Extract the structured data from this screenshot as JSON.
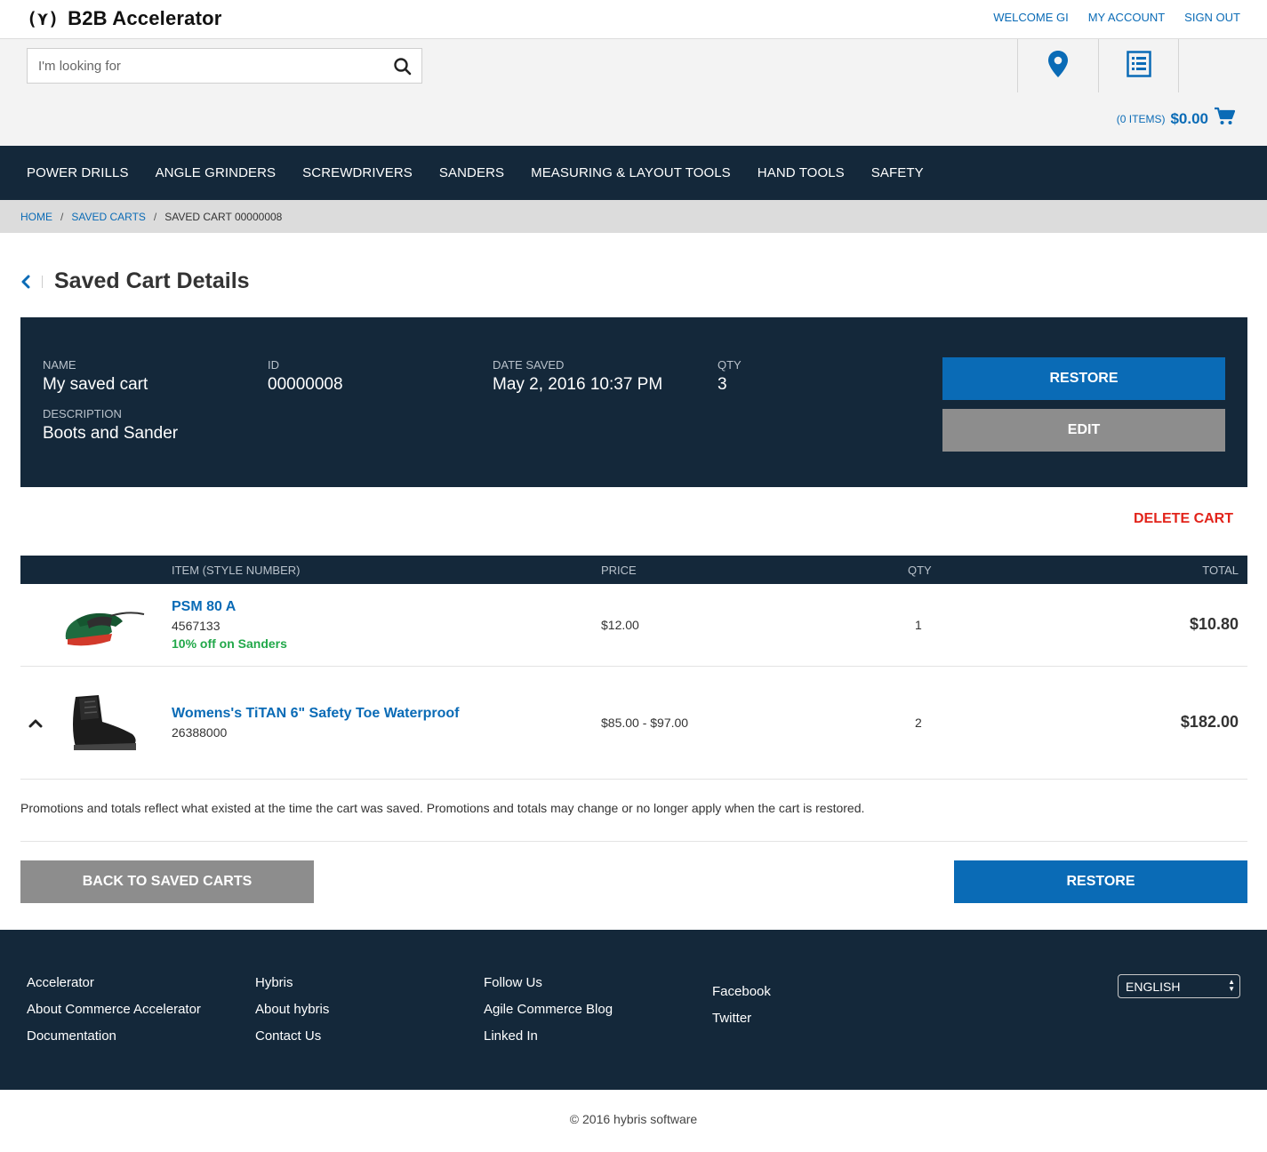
{
  "brand": {
    "logo_mark": "(⋎)",
    "name": "B2B Accelerator"
  },
  "toplinks": {
    "welcome": "WELCOME GI",
    "my_account": "MY ACCOUNT",
    "sign_out": "SIGN OUT"
  },
  "search": {
    "placeholder": "I'm looking for",
    "value": ""
  },
  "header_icons": [
    "location-pin-icon",
    "quick-order-list-icon"
  ],
  "minicart": {
    "items_label": "(0 ITEMS)",
    "total": "$0.00"
  },
  "nav": {
    "items": [
      "POWER DRILLS",
      "ANGLE GRINDERS",
      "SCREWDRIVERS",
      "SANDERS",
      "MEASURING & LAYOUT TOOLS",
      "HAND TOOLS",
      "SAFETY"
    ]
  },
  "breadcrumb": {
    "home": "HOME",
    "saved_carts": "SAVED CARTS",
    "current": "SAVED CART 00000008",
    "separator": "/"
  },
  "page": {
    "title": "Saved Cart Details"
  },
  "cart": {
    "name_label": "NAME",
    "name": "My saved cart",
    "id_label": "ID",
    "id": "00000008",
    "date_label": "DATE SAVED",
    "date": "May 2, 2016 10:37 PM",
    "qty_label": "QTY",
    "qty": "3",
    "description_label": "DESCRIPTION",
    "description": "Boots and Sander",
    "restore_label": "RESTORE",
    "edit_label": "EDIT",
    "delete_label": "DELETE CART"
  },
  "table": {
    "headers": {
      "item": "ITEM (STYLE NUMBER)",
      "price": "PRICE",
      "qty": "QTY",
      "total": "TOTAL"
    },
    "rows": [
      {
        "name": "PSM 80 A",
        "sku": "4567133",
        "promo": "10% off on Sanders",
        "price": "$12.00",
        "qty": "1",
        "total": "$10.80"
      },
      {
        "name": "Womens's TiTAN 6\" Safety Toe Waterproof",
        "sku": "26388000",
        "promo": "",
        "price": "$85.00 - $97.00",
        "qty": "2",
        "total": "$182.00"
      }
    ]
  },
  "note": "Promotions and totals reflect what existed at the time the cart was saved. Promotions and totals may change or no longer apply when the cart is restored.",
  "actions": {
    "back_label": "BACK TO SAVED CARTS",
    "restore_label": "RESTORE"
  },
  "footer": {
    "col1": [
      "Accelerator",
      "About Commerce Accelerator",
      "Documentation"
    ],
    "col2": [
      "Hybris",
      "About hybris",
      "Contact Us"
    ],
    "col3": [
      "Follow Us",
      "Agile Commerce Blog",
      "Linked In"
    ],
    "col4": [
      "Facebook",
      "Twitter"
    ],
    "language": "ENGLISH",
    "copyright": "© 2016 hybris software"
  },
  "colors": {
    "navy": "#14283a",
    "link_blue": "#0a6bb6",
    "grey_button": "#8d8d8d",
    "delete_red": "#e2231a",
    "promo_green": "#22a84a"
  }
}
